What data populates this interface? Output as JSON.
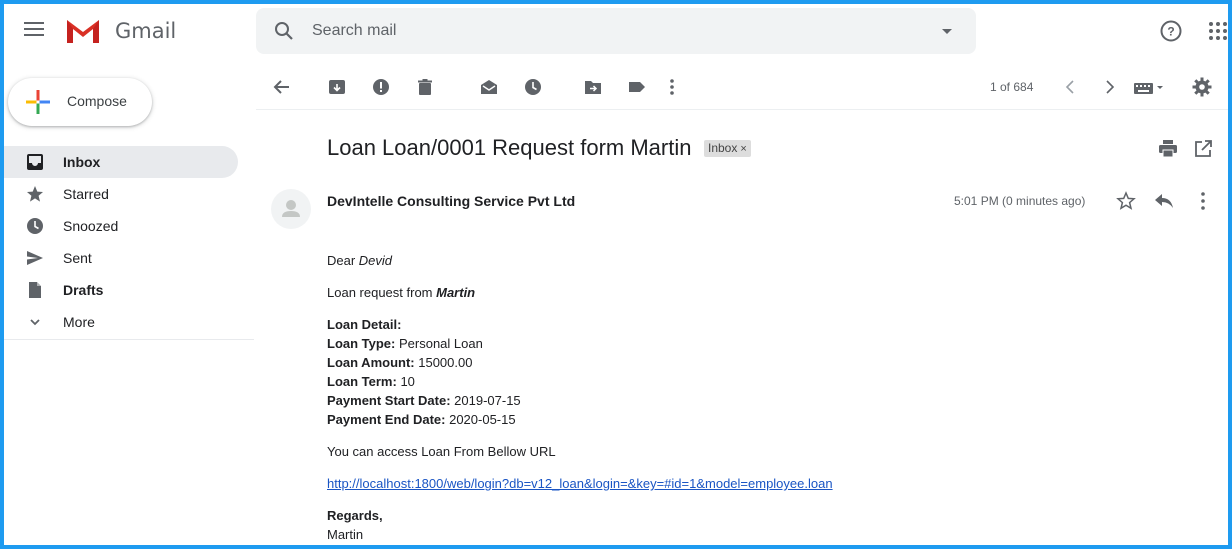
{
  "app": {
    "name": "Gmail"
  },
  "search": {
    "placeholder": "Search mail"
  },
  "sidebar": {
    "compose_label": "Compose",
    "items": [
      {
        "label": "Inbox",
        "icon": "inbox-icon"
      },
      {
        "label": "Starred",
        "icon": "star-icon"
      },
      {
        "label": "Snoozed",
        "icon": "clock-icon"
      },
      {
        "label": "Sent",
        "icon": "send-icon"
      },
      {
        "label": "Drafts",
        "icon": "draft-icon"
      },
      {
        "label": "More",
        "icon": "chevron-down-icon"
      }
    ]
  },
  "toolbar": {
    "pager": "1 of 684"
  },
  "email": {
    "subject": "Loan Loan/0001 Request form Martin",
    "label": "Inbox",
    "label_remove": "×",
    "sender": "DevIntelle Consulting Service Pvt Ltd",
    "time": "5:01 PM (0 minutes ago)",
    "greeting": "Dear ",
    "greeting_name": "Devid",
    "request_text": "Loan request from ",
    "request_name": "Martin",
    "detail_heading": "Loan Detail:",
    "type_label": "Loan Type:",
    "type_value": " Personal Loan",
    "amount_label": "Loan Amount:",
    "amount_value": " 15000.00",
    "term_label": "Loan Term:",
    "term_value": " 10",
    "start_label": "Payment Start Date:",
    "start_value": " 2019-07-15",
    "end_label": "Payment End Date:",
    "end_value": " 2020-05-15",
    "access_text": "You can access Loan From Bellow URL",
    "url": "http://localhost:1800/web/login?db=v12_loan&login=&key=#id=1&model=employee.loan",
    "regards": "Regards,",
    "signature": "Martin"
  },
  "colors": {
    "accent": "#1e9bf0",
    "link": "#1a55c4",
    "active_nav": "#e8eaed"
  }
}
